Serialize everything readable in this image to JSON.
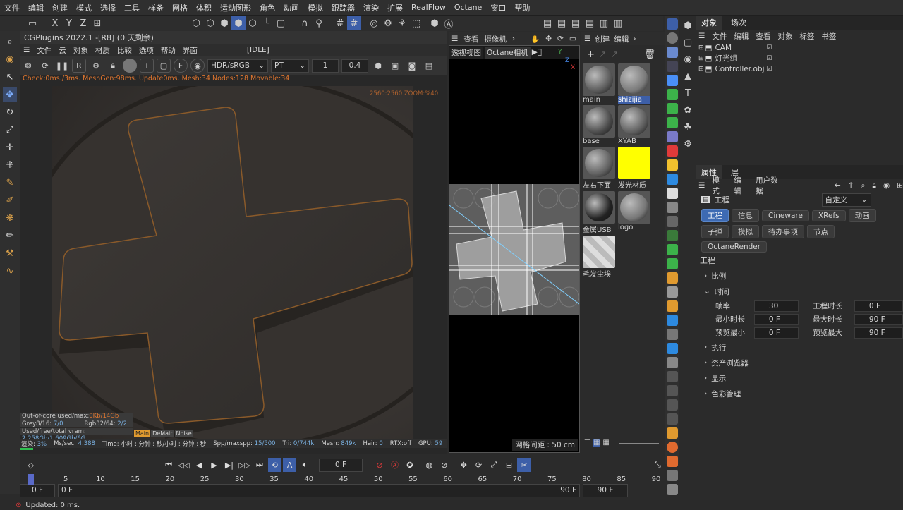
{
  "menu": [
    "文件",
    "编辑",
    "创建",
    "模式",
    "选择",
    "工具",
    "样条",
    "网格",
    "体积",
    "运动图形",
    "角色",
    "动画",
    "模拟",
    "跟踪器",
    "渲染",
    "扩展",
    "RealFlow",
    "Octane",
    "窗口",
    "帮助"
  ],
  "axis": [
    "X",
    "Y",
    "Z"
  ],
  "viewport": {
    "title": "CGPlugins   2022.1 -[R8] (0 天剩余)",
    "menu": [
      "文件",
      "云",
      "对象",
      "材质",
      "比较",
      "选项",
      "帮助",
      "界面"
    ],
    "status": "[IDLE]",
    "colorspace": "HDR/sRGB",
    "kernel": "PT",
    "value1": "1",
    "value2": "0.4",
    "check_line": "Check:0ms./3ms. MeshGen:98ms. Update0ms. Mesh:34 Nodes:128 Movable:34",
    "zoom": "2560:2560 ZOOM:%40",
    "stats": {
      "outofcore_label": "Out-of-core used/max:",
      "outofcore_value": "0Kb/14Gb",
      "grey_label": "Grey8/16:",
      "grey_value": "7/0",
      "rgb_label": "Rgb32/64:",
      "rgb_value": "2/2",
      "vram_label": "Used/free/total vram:",
      "vram_value": "2.258Gb/1.609Gb/6G",
      "tags": [
        "Main",
        "DeMair",
        "Noise"
      ]
    },
    "statusline": [
      "渲染:",
      "3%",
      "Ms/sec:",
      "4.388",
      "Time: 小时 : 分钟 : 秒/小时 : 分钟 : 秒",
      "Spp/maxspp:",
      "15/500",
      "Tri:",
      "0/744k",
      "Mesh:",
      "849k",
      "Hair:",
      "0",
      "RTX:off",
      "GPU:",
      "59"
    ]
  },
  "camera": {
    "menu": [
      "查看",
      "摄像机"
    ],
    "tabs": [
      "透视视图",
      "Octane相机"
    ],
    "grid": "网格间距 : 50 cm",
    "gizmo": [
      "Y",
      "Z",
      "X"
    ]
  },
  "materials": {
    "menu": [
      "创建",
      "编辑"
    ],
    "items": [
      {
        "name": "main",
        "color": "#5a5a5a"
      },
      {
        "name": "shizijia",
        "color": "#7a7a7a"
      },
      {
        "name": "base",
        "color": "#4a4a4a"
      },
      {
        "name": "XYAB",
        "color": "#5d5d5d"
      },
      {
        "name": "左右下面",
        "color": "#606060"
      },
      {
        "name": "发光材质",
        "color": "#ffff00"
      },
      {
        "name": "金属USB",
        "color": "#222222"
      },
      {
        "name": "logo",
        "color": "#777777"
      },
      {
        "name": "毛发尘埃",
        "color": "#cccccc"
      }
    ]
  },
  "objects": {
    "tabs": [
      "对象",
      "场次"
    ],
    "menu": [
      "文件",
      "编辑",
      "查看",
      "对象",
      "标签",
      "书签"
    ],
    "items": [
      "CAM",
      "灯光组",
      "Controller.obj"
    ]
  },
  "attributes": {
    "tabs": [
      "属性",
      "层"
    ],
    "menu": [
      "模式",
      "编辑",
      "用户数据"
    ],
    "title": "工程",
    "preset": "自定义",
    "buttons_row1": [
      "工程",
      "信息",
      "Cineware",
      "XRefs",
      "动画"
    ],
    "buttons_row2": [
      "子弹",
      "模拟",
      "待办事项",
      "节点"
    ],
    "buttons_row3": [
      "OctaneRender"
    ],
    "section_title": "工程",
    "groups": [
      "比例",
      "时间",
      "执行",
      "资产浏览器",
      "显示",
      "色彩管理"
    ],
    "fields": {
      "fps_label": "帧率",
      "fps": "30",
      "project_len_label": "工程时长",
      "project_len": "0 F",
      "min_label": "最小时长",
      "min": "0 F",
      "max_label": "最大时长",
      "max": "90 F",
      "prev_min_label": "预览最小",
      "prev_min": "0 F",
      "prev_max_label": "预览最大",
      "prev_max": "90 F"
    }
  },
  "timeline": {
    "current_frame": "0 F",
    "ticks": [
      "0",
      "5",
      "10",
      "15",
      "20",
      "25",
      "30",
      "35",
      "40",
      "45",
      "50",
      "55",
      "60",
      "65",
      "70",
      "75",
      "80",
      "85",
      "90"
    ],
    "start": "0 F",
    "start2": "0 F",
    "end": "90 F",
    "end2": "90 F"
  },
  "status": "Updated: 0 ms."
}
